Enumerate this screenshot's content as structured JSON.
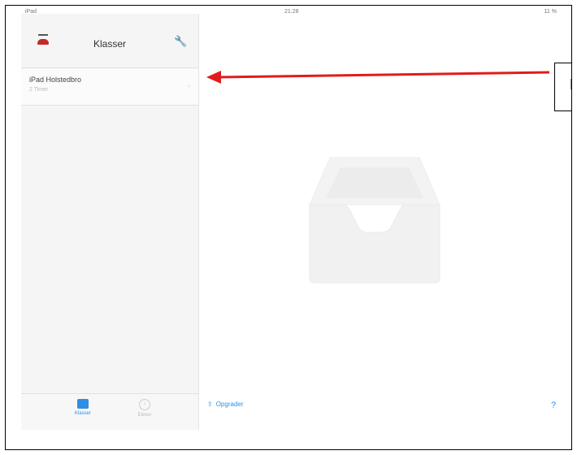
{
  "status_bar": {
    "left": "iPad",
    "time": "21:28",
    "right": "11 %"
  },
  "sidebar": {
    "title": "Klasser",
    "items": [
      {
        "name": "iPad Holstedbro",
        "sub": "2 Timer"
      }
    ],
    "tabs": [
      {
        "label": "Klasser",
        "active": true
      },
      {
        "label": "Elever",
        "active": false
      }
    ]
  },
  "main": {
    "upgrade_label": "Opgrader",
    "help_label": "?"
  },
  "annotation": {
    "callout_text": "N"
  },
  "colors": {
    "accent": "#2f8de4",
    "arrow": "#e21b1b"
  }
}
